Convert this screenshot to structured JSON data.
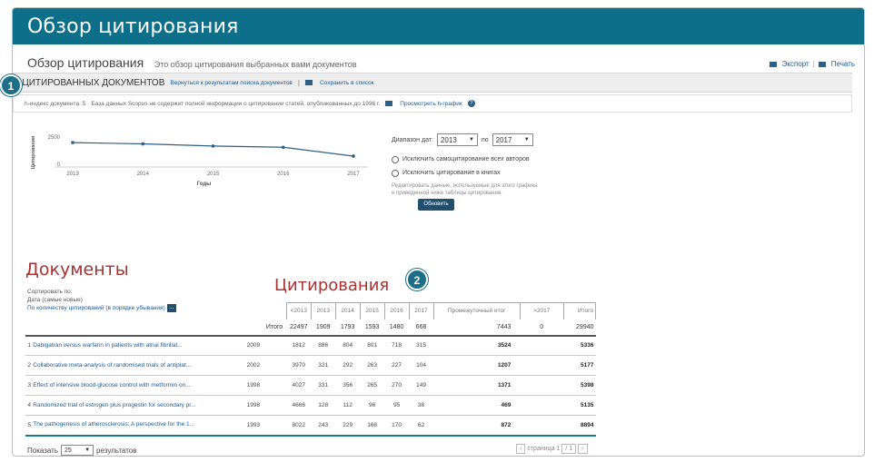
{
  "window": {
    "title": "Обзор цитирования"
  },
  "header": {
    "title": "Обзор цитирования",
    "subtitle": "Это обзор цитирования выбранных вами документов",
    "export_label": "Экспорт",
    "print_label": "Печать"
  },
  "bar": {
    "count_label": "5 ЦИТИРОВАННЫХ ДОКУМЕНТОВ",
    "back_link": "Вернуться к результатам поиска документов",
    "save_link": "Сохранить в список"
  },
  "info": {
    "h_index": "h-индекс документа: 5",
    "scopus_note": "База данных Scopus не содержит полной информации о цитировании статей, опубликованных до 1996 г.",
    "hgraph_link": "Просмотреть h-график"
  },
  "badges": {
    "one": "1",
    "two": "2"
  },
  "chart_data": {
    "type": "line",
    "categories": [
      "2013",
      "2014",
      "2015",
      "2016",
      "2017"
    ],
    "series": [
      {
        "values": [
          1909,
          1793,
          1593,
          1480,
          668
        ]
      }
    ],
    "yticks": [
      "2500",
      "0"
    ],
    "ylim": [
      0,
      2500
    ],
    "xlabel": "Годы",
    "ylabel": "Цитирования",
    "grid": false
  },
  "controls": {
    "range_label": "Диапазон дат:",
    "from_year": "2013",
    "to_label": "по",
    "to_year": "2017",
    "exclude_self": "Исключить самоцитирование всех авторов",
    "exclude_books": "Исключить цитирование в книгах",
    "note": "Редактировать данные, используемые для этого графика и приведенной ниже таблицы цитирования.",
    "update_button": "Обновить"
  },
  "docs_title": "Документы",
  "cit_title": "Цитирования",
  "sort": {
    "label": "Сортировать по:",
    "option1": "Дата (самые новые)",
    "option2": "По количеству цитирований (в порядке убывания)",
    "more": "..."
  },
  "table": {
    "headers": [
      "<2013",
      "2013",
      "2014",
      "2015",
      "2016",
      "2017",
      "Промежуточный итог",
      ">2017",
      "Итого"
    ],
    "total_label": "Итого",
    "totals": [
      "22497",
      "1909",
      "1793",
      "1593",
      "1480",
      "668",
      "7443",
      "0",
      "29940"
    ],
    "rows": [
      {
        "n": "1",
        "title": "Dabigatran versus warfarin in patients with atrial fibrillat...",
        "year": "2009",
        "vals": [
          "1812",
          "886",
          "804",
          "801",
          "718",
          "315"
        ],
        "subtotal": "3524",
        "gt": "",
        "total": "5336"
      },
      {
        "n": "2",
        "title": "Collaborative meta-analysis of randomised trials of antiplat...",
        "year": "2002",
        "vals": [
          "3970",
          "321",
          "292",
          "263",
          "227",
          "104"
        ],
        "subtotal": "1207",
        "gt": "",
        "total": "5177"
      },
      {
        "n": "3",
        "title": "Effect of intensive blood-glucose control with metformin on...",
        "year": "1998",
        "vals": [
          "4027",
          "331",
          "356",
          "265",
          "270",
          "149"
        ],
        "subtotal": "1371",
        "gt": "",
        "total": "5398"
      },
      {
        "n": "4",
        "title": "Randomized trial of estrogen plus progestin for secondary pr...",
        "year": "1998",
        "vals": [
          "4666",
          "128",
          "112",
          "96",
          "95",
          "38"
        ],
        "subtotal": "469",
        "gt": "",
        "total": "5135"
      },
      {
        "n": "5",
        "title": "The pathogenesis of atherosclerosis: A perspective for the 1...",
        "year": "1993",
        "vals": [
          "8022",
          "243",
          "229",
          "168",
          "170",
          "62"
        ],
        "subtotal": "872",
        "gt": "",
        "total": "8894"
      }
    ]
  },
  "footer": {
    "show_label": "Показать",
    "page_size": "25",
    "results_label": "результатов",
    "page_text": "страница 1",
    "of_text": "/ 1"
  }
}
